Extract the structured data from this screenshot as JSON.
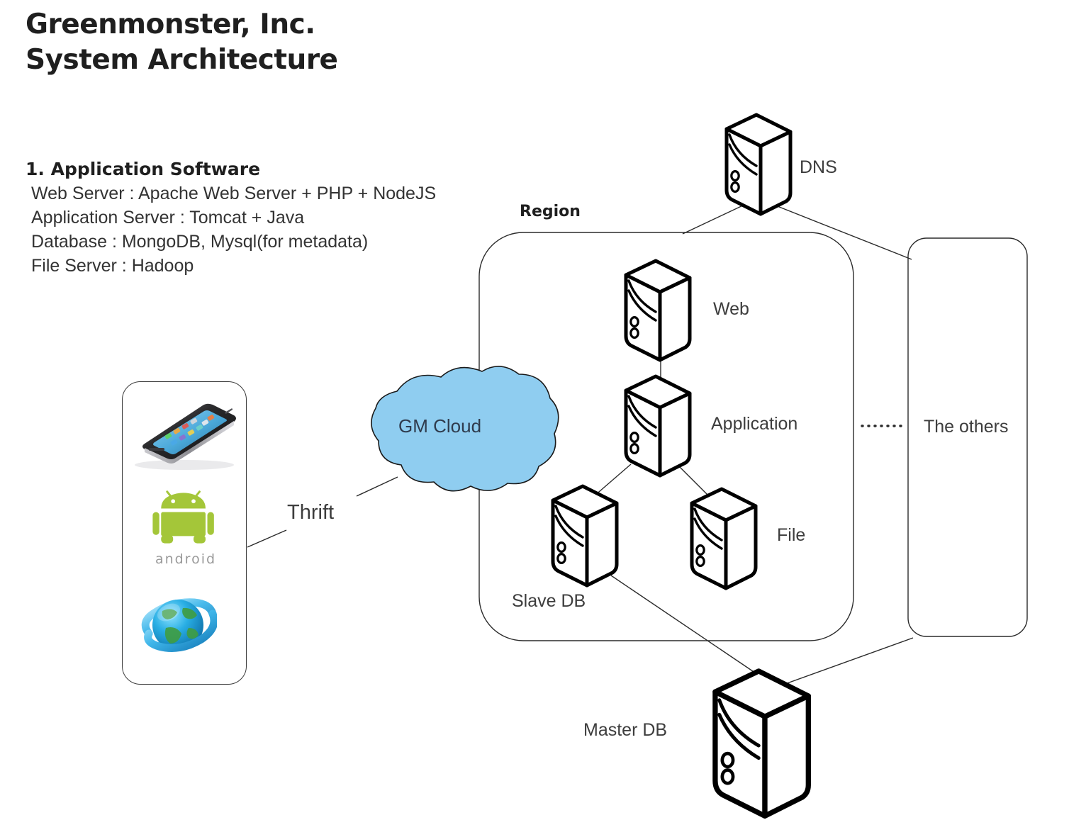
{
  "title": {
    "line1": "Greenmonster, Inc.",
    "line2": "System Architecture"
  },
  "software_section": {
    "heading": "1. Application Software",
    "items": [
      "Web Server : Apache Web Server + PHP + NodeJS",
      "Application Server : Tomcat + Java",
      "Database : MongoDB, Mysql(for metadata)",
      "File Server : Hadoop"
    ]
  },
  "diagram": {
    "region_label": "Region",
    "cloud_label": "GM Cloud",
    "thrift_label": "Thrift",
    "others_label": "The others",
    "android_word": "android",
    "nodes": {
      "dns": "DNS",
      "web": "Web",
      "application": "Application",
      "file": "File",
      "slave_db": "Slave DB",
      "master_db": "Master DB"
    }
  },
  "colors": {
    "cloud_fill": "#8fcdf0",
    "cloud_stroke": "#1a1a1a",
    "line": "#2b2b2b",
    "server_stroke": "#000000",
    "text": "#3d3d3d",
    "android_green": "#a4c639"
  }
}
